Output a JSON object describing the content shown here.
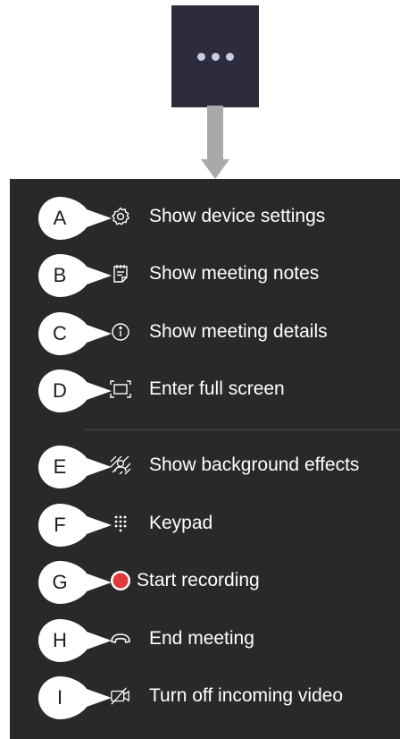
{
  "more_button": {
    "icon": "more-options-icon"
  },
  "menu": {
    "items": [
      {
        "letter": "A",
        "label": "Show device settings",
        "icon": "gear-icon"
      },
      {
        "letter": "B",
        "label": "Show meeting notes",
        "icon": "notes-icon"
      },
      {
        "letter": "C",
        "label": "Show meeting details",
        "icon": "info-icon"
      },
      {
        "letter": "D",
        "label": "Enter full screen",
        "icon": "fullscreen-icon"
      },
      {
        "letter": "E",
        "label": "Show background effects",
        "icon": "background-effects-icon"
      },
      {
        "letter": "F",
        "label": "Keypad",
        "icon": "keypad-icon"
      },
      {
        "letter": "G",
        "label": "Start recording",
        "icon": "record-icon",
        "icon_color": "#e03a3e"
      },
      {
        "letter": "H",
        "label": "End meeting",
        "icon": "hang-up-icon"
      },
      {
        "letter": "I",
        "label": "Turn off incoming video",
        "icon": "video-off-icon"
      }
    ]
  }
}
